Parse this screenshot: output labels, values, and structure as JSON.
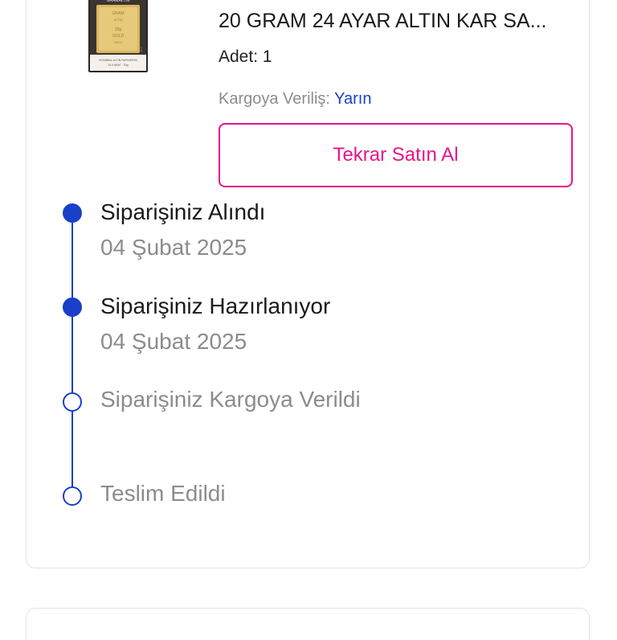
{
  "product": {
    "title": "20 GRAM 24 AYAR ALTIN KAR SA...",
    "quantity": "Adet: 1",
    "ship_label": "Kargoya Veriliş:",
    "ship_value": "Yarın",
    "thumbnail_icon": "gold-bar-thumbnail"
  },
  "actions": {
    "rebuy_label": "Tekrar Satın Al"
  },
  "timeline": {
    "steps": [
      {
        "title": "Siparişiniz Alındı",
        "date": "04 Şubat 2025",
        "state": "done"
      },
      {
        "title": "Siparişiniz Hazırlanıyor",
        "date": "04 Şubat 2025",
        "state": "done"
      },
      {
        "title": "Siparişiniz Kargoya Verildi",
        "date": "",
        "state": "pending"
      },
      {
        "title": "Teslim Edildi",
        "date": "",
        "state": "pending"
      }
    ]
  },
  "colors": {
    "accent_blue": "#1a3fc8",
    "accent_pink": "#e6148a",
    "muted_text": "#8c8c8c"
  }
}
